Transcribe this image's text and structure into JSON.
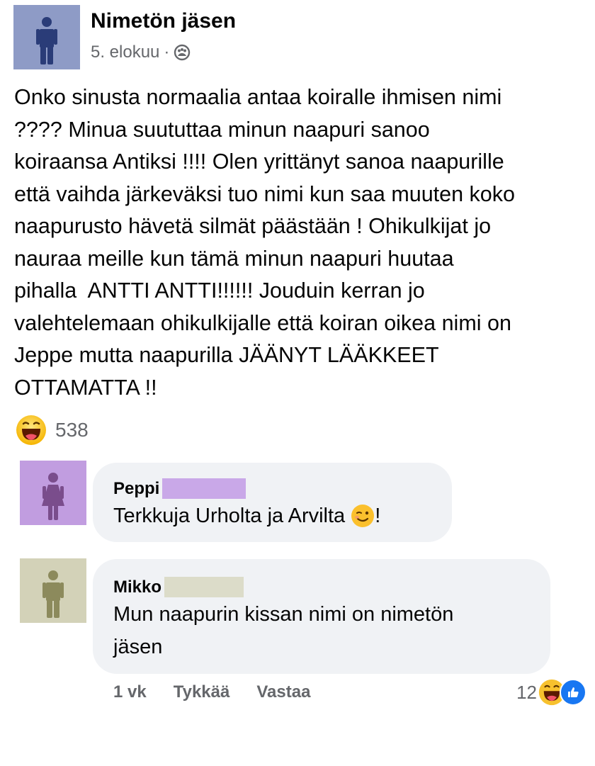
{
  "post": {
    "author": "Nimetön jäsen",
    "date": "5. elokuu",
    "separator": "·",
    "privacy_icon": "group-icon",
    "text": "Onko sinusta normaalia antaa koiralle ihmisen nimi\n???? Minua suututtaa minun naapuri sanoo\nkoiraansa Antiksi !!!! Olen yrittänyt sanoa naapurille\nettä vaihda järkeväksi tuo nimi kun saa muuten koko\nnaapurusto hävetä silmät päästään ! Ohikulkijat jo\nnauraa meille kun tämä minun naapuri huutaa\npihalla  ANTTI ANTTI!!!!!! Jouduin kerran jo\nvalehtelemaan ohikulkijalle että koiran oikea nimi on\nJeppe mutta naapurilla JÄÄNYT LÄÄKKEET\nOTTAMATTA !!",
    "reaction_icon": "haha-emoji-icon",
    "reaction_count": "538",
    "avatar_color": "#8e9bc6"
  },
  "comments": [
    {
      "name": "Peppi",
      "text": "Terkkuja Urholta ja Arvilta",
      "text_suffix": "!",
      "emoji": "wink-emoji-icon",
      "avatar_color": "#c19de0",
      "figure_color": "#7a4d8c",
      "redact_color": "#c9a8e8"
    },
    {
      "name": "Mikko",
      "text": "Mun naapurin kissan nimi on nimetön\njäsen",
      "avatar_color": "#d3d2b8",
      "figure_color": "#8c8a5c",
      "redact_color": "#dcdcc9",
      "actions": {
        "time": "1 vk",
        "like": "Tykkää",
        "reply": "Vastaa"
      },
      "reaction_count": "12",
      "reaction_icons": [
        "haha-emoji-icon",
        "like-icon"
      ]
    }
  ],
  "colors": {
    "bubble": "#f0f2f5",
    "secondary_text": "#65676b",
    "like_blue": "#1877f2"
  }
}
